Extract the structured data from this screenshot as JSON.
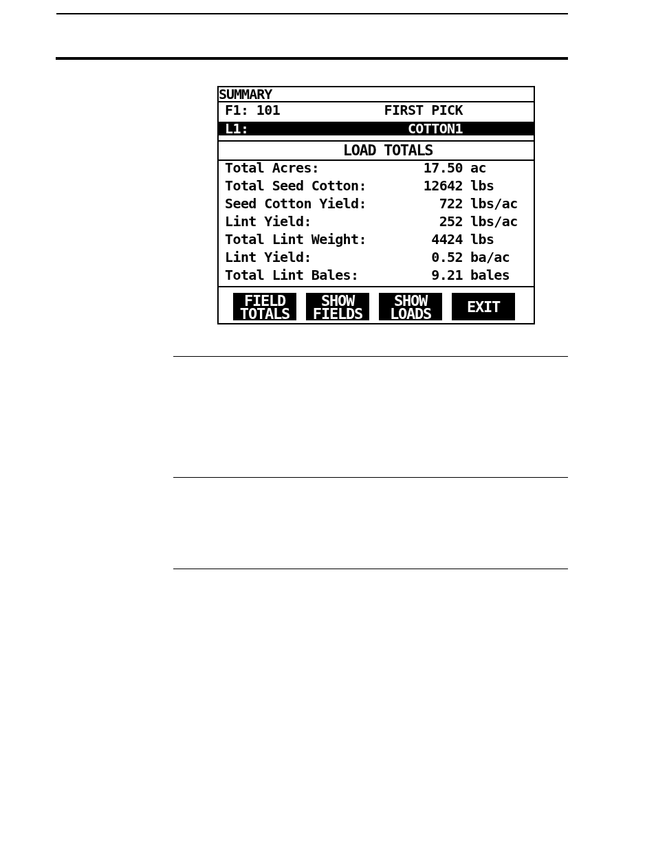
{
  "screen": {
    "title": "SUMMARY",
    "records": [
      {
        "label": "F1: 101",
        "name": "FIRST PICK",
        "selected": false
      },
      {
        "label": "L1:",
        "name": "COTTON1",
        "selected": true
      }
    ],
    "section_title": "LOAD TOTALS",
    "totals": [
      {
        "label": "Total Acres:",
        "value": "17.50",
        "unit": "ac"
      },
      {
        "label": "Total Seed Cotton:",
        "value": "12642",
        "unit": "lbs"
      },
      {
        "label": "Seed Cotton Yield:",
        "value": "722",
        "unit": "lbs/ac"
      },
      {
        "label": "Lint Yield:",
        "value": "252",
        "unit": "lbs/ac"
      },
      {
        "label": "Total Lint Weight:",
        "value": "4424",
        "unit": "lbs"
      },
      {
        "label": "Lint Yield:",
        "value": "0.52",
        "unit": "ba/ac"
      },
      {
        "label": "Total Lint Bales:",
        "value": "9.21",
        "unit": "bales"
      }
    ],
    "buttons": [
      {
        "lines": [
          "FIELD",
          "TOTALS"
        ]
      },
      {
        "lines": [
          "SHOW",
          "FIELDS"
        ]
      },
      {
        "lines": [
          "SHOW",
          "LOADS"
        ]
      },
      {
        "lines": [
          "EXIT"
        ]
      }
    ]
  }
}
